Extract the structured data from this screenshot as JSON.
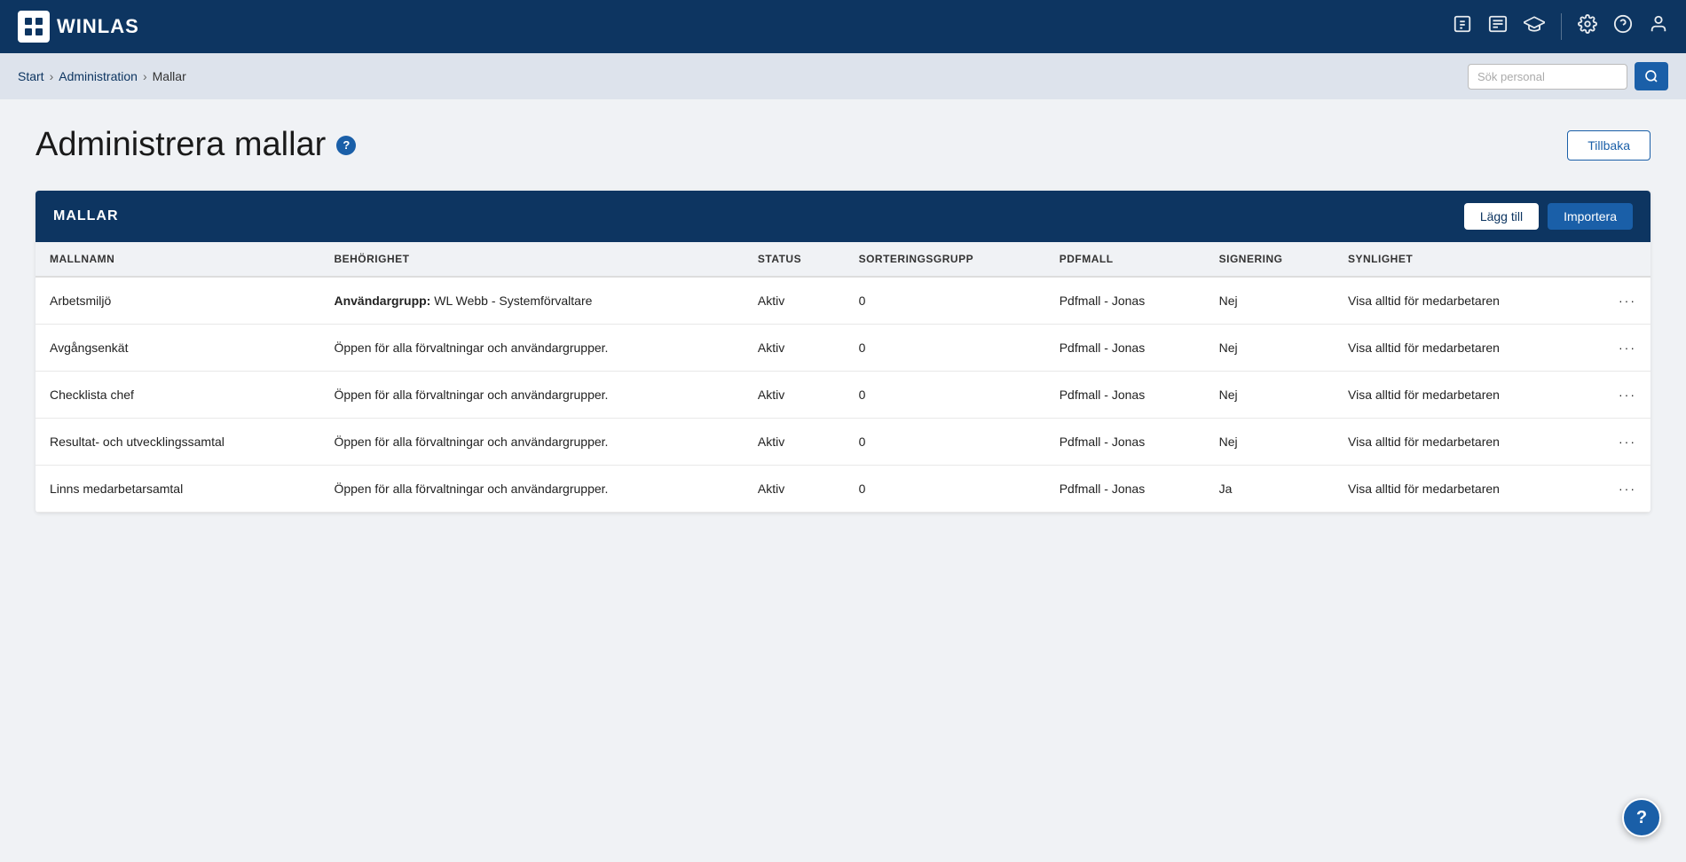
{
  "app": {
    "logo_text": "WinLas",
    "logo_icon_text": "⊞"
  },
  "topnav": {
    "icons": [
      "info-icon",
      "newspaper-icon",
      "graduation-icon",
      "settings-icon",
      "help-icon",
      "user-icon"
    ]
  },
  "breadcrumb": {
    "start_label": "Start",
    "admin_label": "Administration",
    "current_label": "Mallar"
  },
  "search": {
    "placeholder": "Sök personal"
  },
  "page": {
    "title": "Administrera mallar",
    "back_button": "Tillbaka"
  },
  "table": {
    "title": "MALLAR",
    "add_button": "Lägg till",
    "import_button": "Importera",
    "columns": [
      "MALLNAMN",
      "BEHÖRIGHET",
      "STATUS",
      "SORTERINGSGRUPP",
      "PDFMALL",
      "SIGNERING",
      "SYNLIGHET",
      ""
    ],
    "rows": [
      {
        "mallnamn": "Arbetsmiljö",
        "behörighet_label": "Användargrupp:",
        "behörighet_value": "WL Webb - Systemförvaltare",
        "status": "Aktiv",
        "sortering": "0",
        "pdfmall": "Pdfmall - Jonas",
        "signering": "Nej",
        "synlighet": "Visa alltid för medarbetaren"
      },
      {
        "mallnamn": "Avgångsenkät",
        "behörighet_label": "",
        "behörighet_value": "Öppen för alla förvaltningar och användargrupper.",
        "status": "Aktiv",
        "sortering": "0",
        "pdfmall": "Pdfmall - Jonas",
        "signering": "Nej",
        "synlighet": "Visa alltid för medarbetaren"
      },
      {
        "mallnamn": "Checklista chef",
        "behörighet_label": "",
        "behörighet_value": "Öppen för alla förvaltningar och användargrupper.",
        "status": "Aktiv",
        "sortering": "0",
        "pdfmall": "Pdfmall - Jonas",
        "signering": "Nej",
        "synlighet": "Visa alltid för medarbetaren"
      },
      {
        "mallnamn": "Resultat- och utvecklingssamtal",
        "behörighet_label": "",
        "behörighet_value": "Öppen för alla förvaltningar och användargrupper.",
        "status": "Aktiv",
        "sortering": "0",
        "pdfmall": "Pdfmall - Jonas",
        "signering": "Nej",
        "synlighet": "Visa alltid för medarbetaren"
      },
      {
        "mallnamn": "Linns medarbetarsamtal",
        "behörighet_label": "",
        "behörighet_value": "Öppen för alla förvaltningar och användargrupper.",
        "status": "Aktiv",
        "sortering": "0",
        "pdfmall": "Pdfmall - Jonas",
        "signering": "Ja",
        "synlighet": "Visa alltid för medarbetaren"
      }
    ]
  },
  "floating_help": "?"
}
